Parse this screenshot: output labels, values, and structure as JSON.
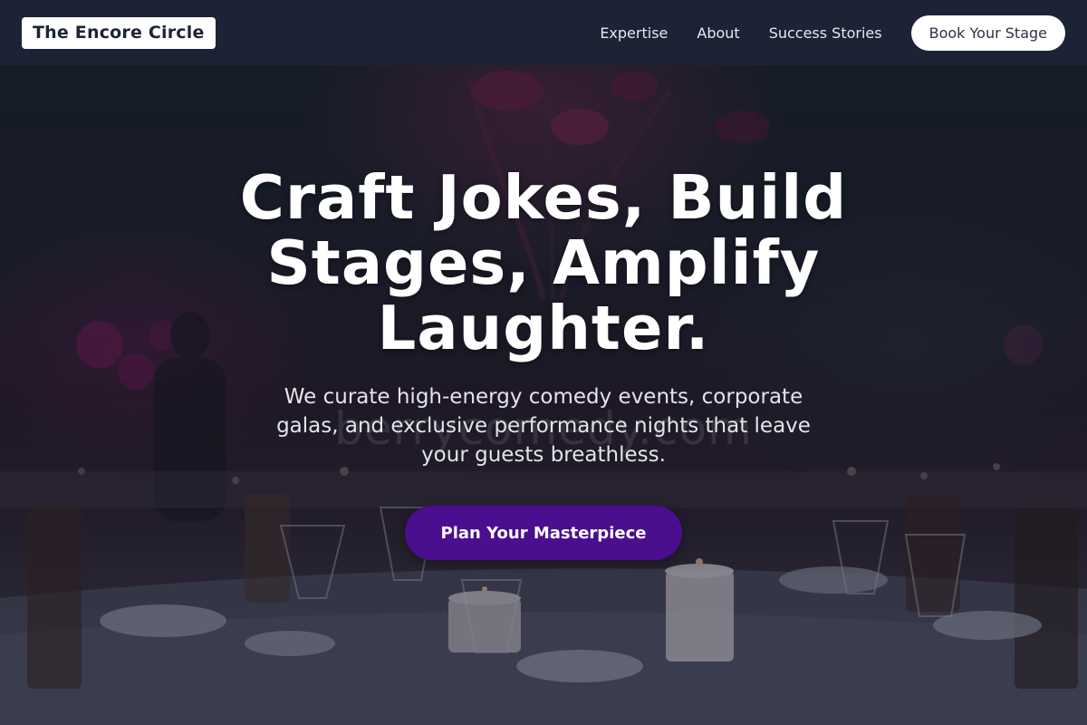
{
  "header": {
    "logo": "The Encore Circle",
    "nav": [
      "Expertise",
      "About",
      "Success Stories"
    ],
    "cta": "Book Your Stage"
  },
  "hero": {
    "title_lines": [
      "Craft Jokes, Build",
      "Stages, Amplify",
      "Laughter."
    ],
    "subtitle": "We curate high-energy comedy events, corporate galas, and exclusive performance nights that leave your guests breathless.",
    "cta": "Plan Your Masterpiece",
    "watermark": "berrycomedy.com"
  },
  "colors": {
    "header_bg": "#1c2436",
    "cta_primary": "#4a0e8f",
    "text_light": "#ffffff"
  }
}
